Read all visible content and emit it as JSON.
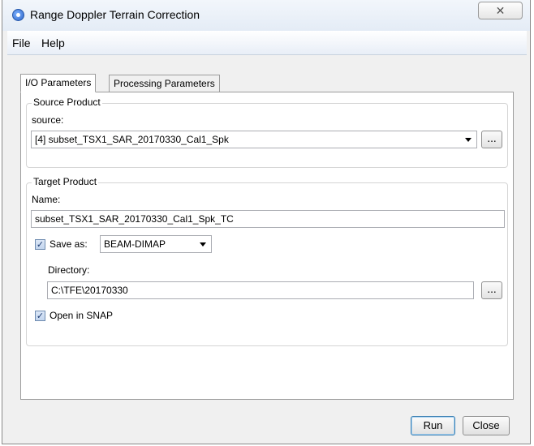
{
  "window": {
    "title": "Range Doppler Terrain Correction",
    "close_glyph": "✕"
  },
  "menu": [
    {
      "label": "File"
    },
    {
      "label": "Help"
    }
  ],
  "tabs": [
    {
      "label": "I/O Parameters",
      "active": true
    },
    {
      "label": "Processing Parameters",
      "active": false
    }
  ],
  "source_group": {
    "title": "Source Product",
    "source_label": "source:",
    "source_value": "[4] subset_TSX1_SAR_20170330_Cal1_Spk",
    "browse_label": "..."
  },
  "target_group": {
    "title": "Target Product",
    "name_label": "Name:",
    "name_value": "subset_TSX1_SAR_20170330_Cal1_Spk_TC",
    "save_as_checked": true,
    "save_as_label": "Save as:",
    "format_value": "BEAM-DIMAP",
    "directory_label": "Directory:",
    "directory_value": "C:\\TFE\\20170330",
    "browse_label": "...",
    "open_in_snap_checked": true,
    "open_in_snap_label": "Open in SNAP"
  },
  "buttons": {
    "run": "Run",
    "close": "Close"
  },
  "icons": {
    "app": "snap-app-icon",
    "check": "checkmark-icon",
    "dropdown": "chevron-down-icon"
  }
}
